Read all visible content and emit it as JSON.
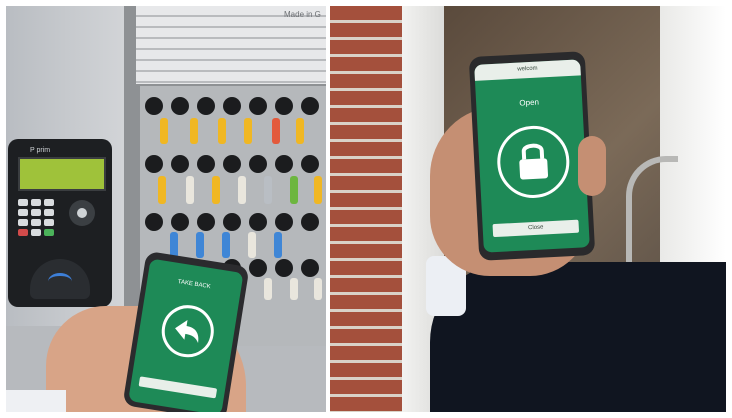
{
  "left_photo": {
    "cabinet_text": "Made in G",
    "reader_brand": "P prim",
    "phone": {
      "screen_title": "TAKE BACK",
      "button_label": "",
      "icon": "return-arrow-icon",
      "screen_color": "#1e8a57"
    }
  },
  "right_photo": {
    "phone": {
      "header": "welcom",
      "status_text": "Open",
      "button_label": "Close",
      "icon": "padlock-open-icon",
      "screen_color": "#1e8a57"
    }
  }
}
